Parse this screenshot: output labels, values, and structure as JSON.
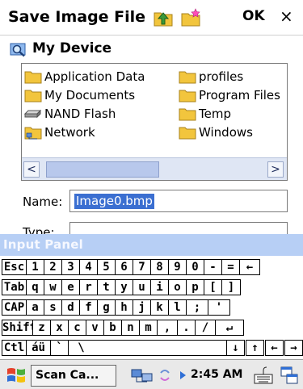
{
  "dialog": {
    "title": "Save Image File",
    "ok_label": "OK",
    "close_label": "×"
  },
  "location": {
    "label": "My Device"
  },
  "files": [
    {
      "name": "Application Data",
      "icon": "folder-icon"
    },
    {
      "name": "My Documents",
      "icon": "folder-icon"
    },
    {
      "name": "NAND Flash",
      "icon": "drive-icon"
    },
    {
      "name": "Network",
      "icon": "network-folder-icon"
    },
    {
      "name": "profiles",
      "icon": "folder-icon"
    },
    {
      "name": "Program Files",
      "icon": "folder-icon"
    },
    {
      "name": "Temp",
      "icon": "folder-icon"
    },
    {
      "name": "Windows",
      "icon": "folder-icon"
    }
  ],
  "scrollbar": {
    "left_arrow": "<",
    "right_arrow": ">"
  },
  "form": {
    "name_label": "Name:",
    "name_value": "Image0.bmp",
    "type_label": "Type:"
  },
  "input_panel": {
    "title": "Input Panel",
    "rows": [
      [
        "Esc",
        "1",
        "2",
        "3",
        "4",
        "5",
        "6",
        "7",
        "8",
        "9",
        "0",
        "-",
        "=",
        "←"
      ],
      [
        "Tab",
        "q",
        "w",
        "e",
        "r",
        "t",
        "y",
        "u",
        "i",
        "o",
        "p",
        "[",
        "]"
      ],
      [
        "CAP",
        "a",
        "s",
        "d",
        "f",
        "g",
        "h",
        "j",
        "k",
        "l",
        ";",
        "'"
      ],
      [
        "Shift",
        "z",
        "x",
        "c",
        "v",
        "b",
        "n",
        "m",
        ",",
        ".",
        "/",
        "↵"
      ],
      [
        "Ctl",
        "áü",
        "`",
        "\\",
        "↓",
        "↑",
        "←",
        "→"
      ]
    ]
  },
  "taskbar": {
    "task_label": "Scan Ca...",
    "time": "2:45 AM"
  },
  "colors": {
    "selection": "#3b6fd1",
    "input_panel_header": "#b7cff5",
    "folder": "#f2c53d"
  }
}
